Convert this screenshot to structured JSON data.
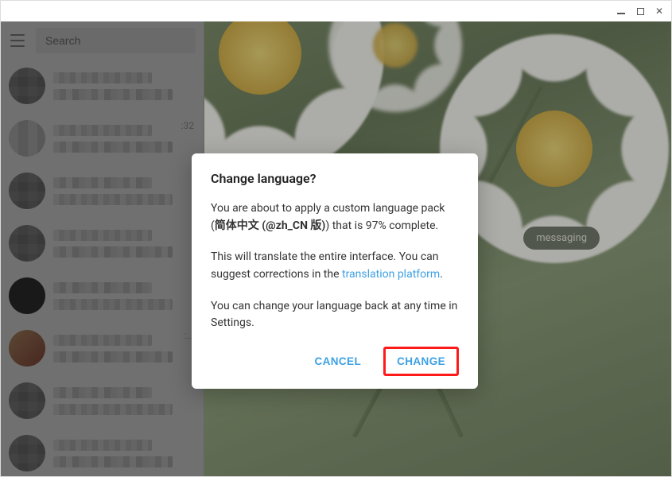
{
  "window_controls": {
    "minimize": "–",
    "maximize": "□",
    "close": "✕"
  },
  "sidebar": {
    "search_placeholder": "Search",
    "items": [
      {
        "time": ""
      },
      {
        "time": ":32"
      },
      {
        "time": ""
      },
      {
        "time": ""
      },
      {
        "time": ""
      },
      {
        "time": ":..."
      },
      {
        "time": ""
      },
      {
        "time": ""
      }
    ]
  },
  "chat": {
    "badge_text": "messaging"
  },
  "dialog": {
    "title": "Change language?",
    "p1_a": "You are about to apply a custom language pack (",
    "p1_b": "简体中文 (@zh_CN 版)",
    "p1_c": ") that is 97% complete.",
    "p2_a": "This will translate the entire interface. You can suggest corrections in the ",
    "p2_link": "translation platform",
    "p2_b": ".",
    "p3": "You can change your language back at any time in Settings.",
    "cancel": "CANCEL",
    "confirm": "CHANGE"
  }
}
